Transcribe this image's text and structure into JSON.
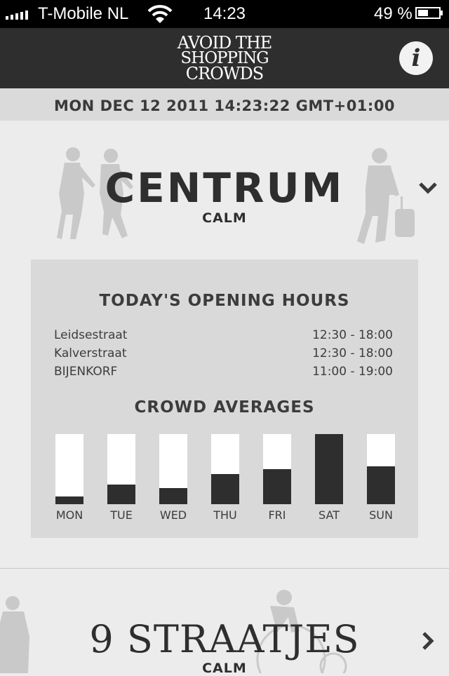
{
  "status_bar": {
    "carrier": "T-Mobile NL",
    "time": "14:23",
    "battery": "49 %",
    "battery_level": 0.49
  },
  "header": {
    "logo_lines": [
      "AVOID THE",
      "SHOPPING",
      "CROWDS"
    ],
    "info_icon": "i"
  },
  "datetime": "MON DEC 12 2011 14:23:22 GMT+01:00",
  "centrum": {
    "title": "CENTRUM",
    "status": "CALM",
    "opening_hours": {
      "heading": "TODAY'S OPENING HOURS",
      "rows": [
        {
          "name": "Leidsestraat",
          "time": "12:30 - 18:00"
        },
        {
          "name": "Kalverstraat",
          "time": "12:30 - 18:00"
        },
        {
          "name": "BIJENKORF",
          "time": "11:00 - 19:00"
        }
      ]
    },
    "crowd_averages": {
      "heading": "CROWD AVERAGES"
    }
  },
  "chart_data": {
    "type": "bar",
    "title": "CROWD AVERAGES",
    "categories": [
      "MON",
      "TUE",
      "WED",
      "THU",
      "FRI",
      "SAT",
      "SUN"
    ],
    "values": [
      0.11,
      0.28,
      0.23,
      0.43,
      0.5,
      1.0,
      0.54
    ],
    "ylim": [
      0,
      1
    ],
    "colors": {
      "fill": "#2e2e2e",
      "empty": "#ffffff"
    }
  },
  "straatjes": {
    "title": "9 STRAATJES",
    "status": "CALM"
  },
  "icons": {
    "expand": "chevron-down-icon",
    "navigate": "chevron-right-icon",
    "info": "info-icon",
    "wifi": "wifi-icon",
    "signal": "signal-icon",
    "battery": "battery-icon"
  }
}
